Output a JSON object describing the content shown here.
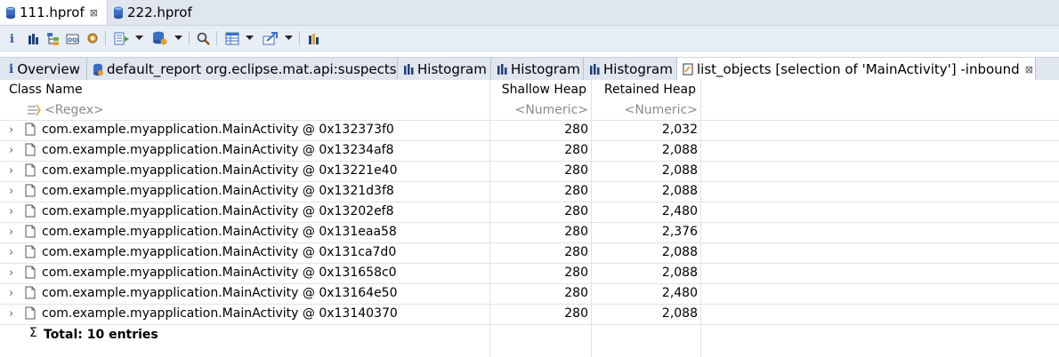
{
  "editor_tabs": [
    {
      "label": "111.hprof",
      "active": true,
      "close": "⊠"
    },
    {
      "label": "222.hprof",
      "active": false
    }
  ],
  "view_tabs": [
    {
      "label": "Overview"
    },
    {
      "label": "default_report  org.eclipse.mat.api:suspects"
    },
    {
      "label": "Histogram"
    },
    {
      "label": "Histogram"
    },
    {
      "label": "Histogram"
    },
    {
      "label": "list_objects [selection of 'MainActivity'] -inbound",
      "close": "⊠"
    }
  ],
  "toolbar_icons": [
    "info-icon",
    "histogram-icon",
    "dominator-tree-icon",
    "oql-icon",
    "heap-dump-overview-icon",
    "run-report-icon",
    "dropdown-icon",
    "query-browser-icon",
    "dropdown-icon",
    "search-icon",
    "table-layout-icon",
    "dropdown-icon",
    "export-icon",
    "dropdown-icon",
    "calculate-retained-icon"
  ],
  "table": {
    "columns": {
      "class_name": "Class Name",
      "shallow_heap": "Shallow Heap",
      "retained_heap": "Retained Heap"
    },
    "filters": {
      "class_name": "<Regex>",
      "shallow_heap": "<Numeric>",
      "retained_heap": "<Numeric>"
    },
    "rows": [
      {
        "name": "com.example.myapplication.MainActivity @ 0x132373f0",
        "shallow": "280",
        "retained": "2,032"
      },
      {
        "name": "com.example.myapplication.MainActivity @ 0x13234af8",
        "shallow": "280",
        "retained": "2,088"
      },
      {
        "name": "com.example.myapplication.MainActivity @ 0x13221e40",
        "shallow": "280",
        "retained": "2,088"
      },
      {
        "name": "com.example.myapplication.MainActivity @ 0x1321d3f8",
        "shallow": "280",
        "retained": "2,088"
      },
      {
        "name": "com.example.myapplication.MainActivity @ 0x13202ef8",
        "shallow": "280",
        "retained": "2,480"
      },
      {
        "name": "com.example.myapplication.MainActivity @ 0x131eaa58",
        "shallow": "280",
        "retained": "2,376"
      },
      {
        "name": "com.example.myapplication.MainActivity @ 0x131ca7d0",
        "shallow": "280",
        "retained": "2,088"
      },
      {
        "name": "com.example.myapplication.MainActivity @ 0x131658c0",
        "shallow": "280",
        "retained": "2,088"
      },
      {
        "name": "com.example.myapplication.MainActivity @ 0x13164e50",
        "shallow": "280",
        "retained": "2,480"
      },
      {
        "name": "com.example.myapplication.MainActivity @ 0x13140370",
        "shallow": "280",
        "retained": "2,088"
      }
    ],
    "total_symbol": "Σ",
    "total_label": "Total: 10 entries"
  },
  "colors": {
    "tab_bar": "#dfe6ef",
    "toolbar": "#e8eef6",
    "grid": "#e3e3e3",
    "icon_blue": "#2a56a8"
  }
}
